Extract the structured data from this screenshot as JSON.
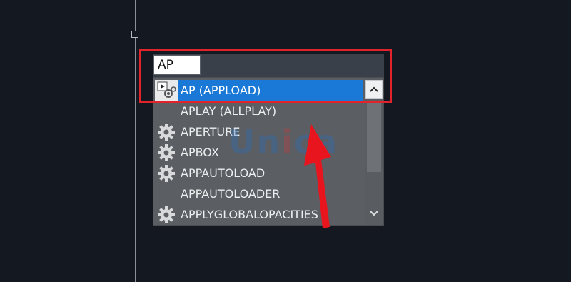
{
  "command_line": {
    "input_value": "AP"
  },
  "autocomplete": {
    "items": [
      {
        "label": "AP (APPLOAD)",
        "icon": "appload-icon",
        "selected": true
      },
      {
        "label": "APLAY (ALLPLAY)",
        "icon": "none",
        "selected": false
      },
      {
        "label": "APERTURE",
        "icon": "gear-icon",
        "selected": false
      },
      {
        "label": "APBOX",
        "icon": "gear-icon",
        "selected": false
      },
      {
        "label": "APPAUTOLOAD",
        "icon": "gear-icon",
        "selected": false
      },
      {
        "label": "APPAUTOLOADER",
        "icon": "none",
        "selected": false
      },
      {
        "label": "APPLYGLOBALOPACITIES",
        "icon": "gear-icon",
        "selected": false
      }
    ]
  },
  "watermark": {
    "text_main": "Un",
    "text_accent": "i",
    "text_tail": "ca"
  },
  "colors": {
    "canvas_background": "#141820",
    "selection": "#1a78d6",
    "highlight_annotation": "#e2232b",
    "arrow_annotation": "#e8141e"
  }
}
